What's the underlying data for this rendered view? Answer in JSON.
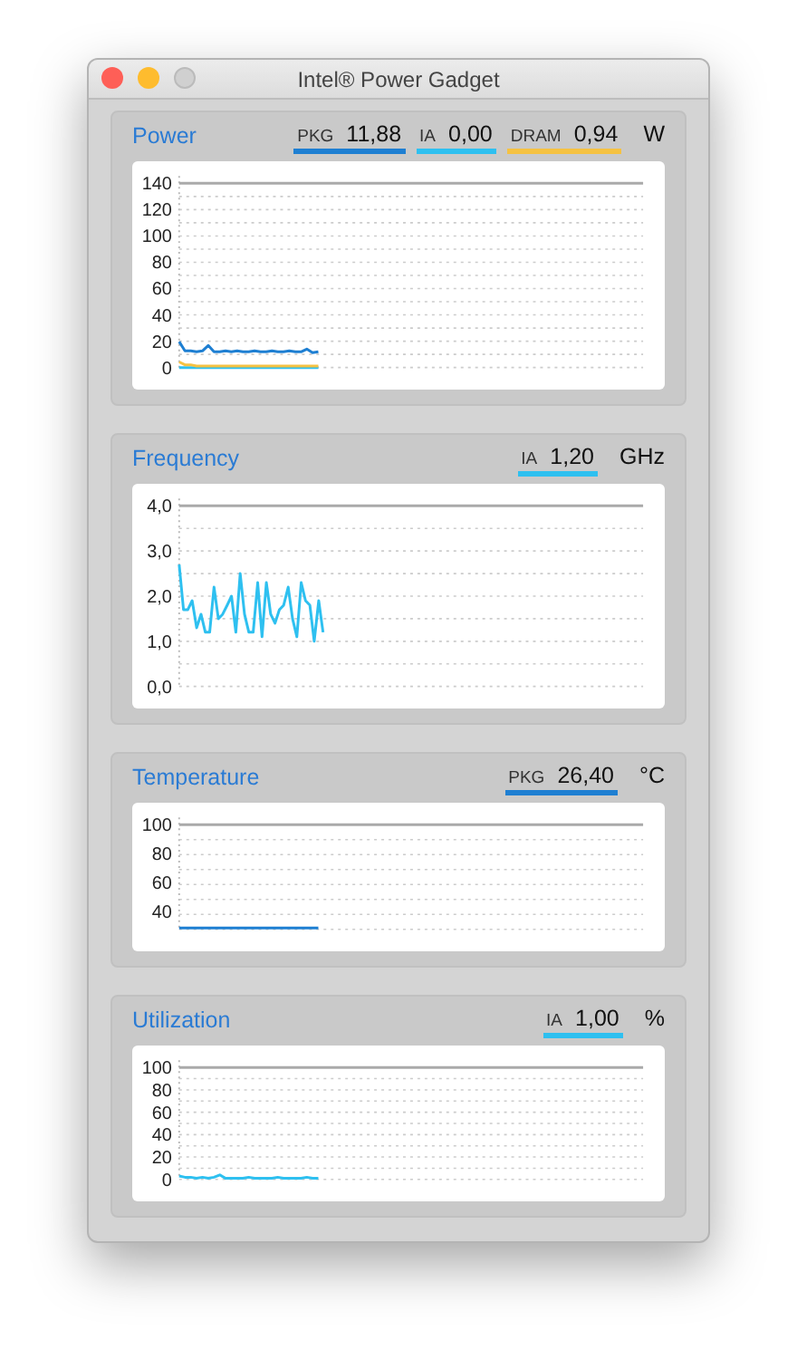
{
  "window": {
    "title": "Intel® Power Gadget",
    "controls": [
      {
        "kind": "close",
        "disabled": false
      },
      {
        "kind": "minimize",
        "disabled": false
      },
      {
        "kind": "zoom",
        "disabled": true
      }
    ]
  },
  "panels": [
    {
      "title": "Power",
      "unit": "W",
      "readings": [
        {
          "label": "PKG",
          "value": "11,88",
          "color": "#1e7fd2"
        },
        {
          "label": "IA",
          "value": "0,00",
          "color": "#2ec0f0"
        },
        {
          "label": "DRAM",
          "value": "0,94",
          "color": "#f5c242"
        }
      ],
      "axis_labels": [
        "140",
        "120",
        "100",
        "80",
        "60",
        "40",
        "20",
        "0"
      ]
    },
    {
      "title": "Frequency",
      "unit": "GHz",
      "readings": [
        {
          "label": "IA",
          "value": "1,20",
          "color": "#2ec0f0"
        }
      ],
      "axis_labels": [
        "4,0",
        "3,0",
        "2,0",
        "1,0",
        "0,0"
      ]
    },
    {
      "title": "Temperature",
      "unit": "°C",
      "readings": [
        {
          "label": "PKG",
          "value": "26,40",
          "color": "#1e7fd2"
        }
      ],
      "axis_labels": [
        "100",
        "80",
        "60",
        "40"
      ]
    },
    {
      "title": "Utilization",
      "unit": "%",
      "readings": [
        {
          "label": "IA",
          "value": "1,00",
          "color": "#2ec0f0"
        }
      ],
      "axis_labels": [
        "100",
        "80",
        "60",
        "40",
        "20",
        "0"
      ]
    }
  ]
}
